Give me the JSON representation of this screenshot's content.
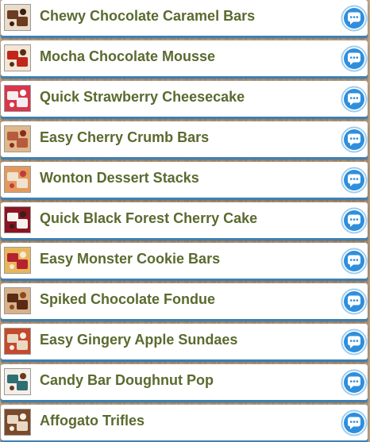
{
  "recipes": [
    {
      "title": "Chewy Chocolate Caramel Bars",
      "thumb_icon": "chocolate-caramel-bars-thumbnail",
      "colors": [
        "#6b3b22",
        "#e9dcc9",
        "#3a1e10"
      ]
    },
    {
      "title": "Mocha Chocolate Mousse",
      "thumb_icon": "mocha-mousse-thumbnail",
      "colors": [
        "#c0261c",
        "#f3e6d4",
        "#5a2c18"
      ]
    },
    {
      "title": "Quick Strawberry Cheesecake",
      "thumb_icon": "strawberry-cheesecake-thumbnail",
      "colors": [
        "#f4eef0",
        "#d8364b",
        "#ffffff"
      ]
    },
    {
      "title": "Easy Cherry Crumb Bars",
      "thumb_icon": "cherry-crumb-bars-thumbnail",
      "colors": [
        "#b75b3e",
        "#e0b88a",
        "#8a2b1f"
      ]
    },
    {
      "title": "Wonton Dessert Stacks",
      "thumb_icon": "wonton-dessert-thumbnail",
      "colors": [
        "#f1e2cf",
        "#e39a5d",
        "#c23b3b"
      ]
    },
    {
      "title": "Quick Black Forest Cherry Cake",
      "thumb_icon": "black-forest-cake-thumbnail",
      "colors": [
        "#f6f2ee",
        "#8b1523",
        "#3a1d16"
      ]
    },
    {
      "title": "Easy Monster Cookie Bars",
      "thumb_icon": "monster-cookie-bars-thumbnail",
      "colors": [
        "#b5222f",
        "#e8b65a",
        "#f6e9d6"
      ]
    },
    {
      "title": "Spiked Chocolate Fondue",
      "thumb_icon": "chocolate-fondue-thumbnail",
      "colors": [
        "#5a2a14",
        "#d8b28a",
        "#8c4a1e"
      ]
    },
    {
      "title": "Easy Gingery Apple Sundaes",
      "thumb_icon": "apple-sundae-thumbnail",
      "colors": [
        "#e9d8c2",
        "#c54a2c",
        "#f6efe6"
      ]
    },
    {
      "title": "Candy Bar Doughnut Pop",
      "thumb_icon": "doughnut-pop-thumbnail",
      "colors": [
        "#2f6f73",
        "#f3efe8",
        "#6b3a1e"
      ]
    },
    {
      "title": "Affogato Trifles",
      "thumb_icon": "affogato-trifle-thumbnail",
      "colors": [
        "#e8d9c5",
        "#7b4a2a",
        "#f7f1e8"
      ]
    }
  ],
  "chat_icon": "speech-bubble-icon",
  "colors": {
    "title_text": "#5a6a2f",
    "row_background": "#ffffff",
    "row_underline": "#3e80b3",
    "chat_button": "#2f8fdc"
  }
}
